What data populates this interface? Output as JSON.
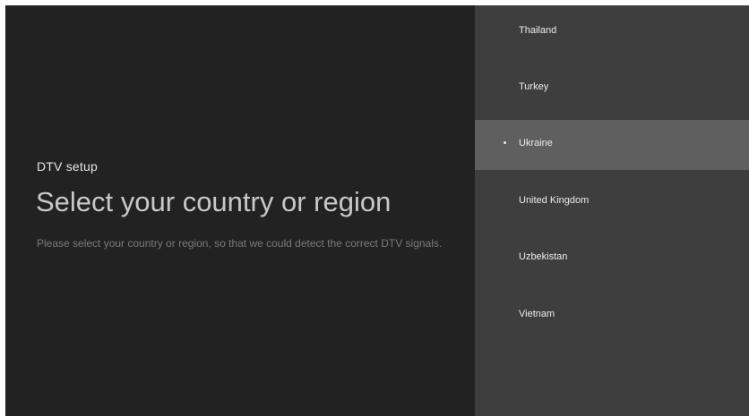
{
  "setup": {
    "section_label": "DTV setup",
    "title": "Select your country or region",
    "description": "Please select your country or region, so that we could detect the correct DTV signals."
  },
  "country_list": {
    "items": [
      {
        "label": "Thailand",
        "selected": false
      },
      {
        "label": "Turkey",
        "selected": false
      },
      {
        "label": "Ukraine",
        "selected": true
      },
      {
        "label": "United Kingdom",
        "selected": false
      },
      {
        "label": "Uzbekistan",
        "selected": false
      },
      {
        "label": "Vietnam",
        "selected": false
      }
    ]
  },
  "colors": {
    "background": "#222222",
    "list_background": "#3e3e3e",
    "selected_background": "#5f5f5f"
  }
}
